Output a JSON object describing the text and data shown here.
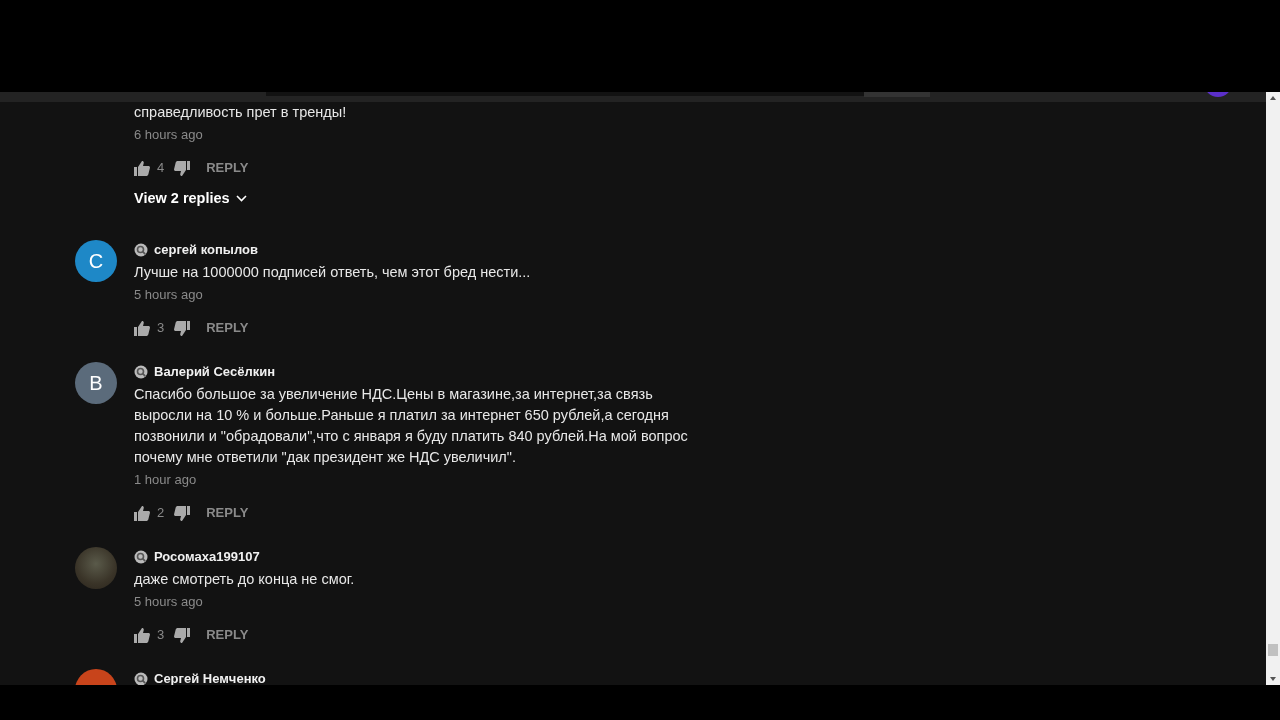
{
  "top_comment": {
    "text": "справедливость прет в тренды!",
    "time": "6 hours ago",
    "likes": "4",
    "reply": "REPLY",
    "view_replies": "View 2 replies"
  },
  "comments": [
    {
      "author": "сергей копылов",
      "avatar": {
        "kind": "letter",
        "letter": "С",
        "color": "#1e88c7"
      },
      "text": "Лучше на 1000000 подписей ответь, чем этот бред нести...",
      "time": "5 hours ago",
      "likes": "3",
      "reply": "REPLY"
    },
    {
      "author": "Валерий Сесёлкин",
      "avatar": {
        "kind": "letter",
        "letter": "В",
        "color": "#5b6b7b"
      },
      "text": "Спасибо большое за увеличение НДС.Цены в магазине,за интернет,за связь выросли на 10 % и больше.Раньше я платил за интернет 650 рублей,а сегодня позвонили и \"обрадовали\",что с января я буду платить 840 рублей.На мой вопрос почему мне ответили \"дак президент же НДС увеличил\".",
      "time": "1 hour ago",
      "likes": "2",
      "reply": "REPLY"
    },
    {
      "author": "Росомаха199107",
      "avatar": {
        "kind": "photo"
      },
      "text": "даже смотреть до конца не смог.",
      "time": "5 hours ago",
      "likes": "3",
      "reply": "REPLY"
    },
    {
      "author": "Сергей Немченко",
      "avatar": {
        "kind": "letter",
        "color": "#c8441b"
      }
    }
  ]
}
